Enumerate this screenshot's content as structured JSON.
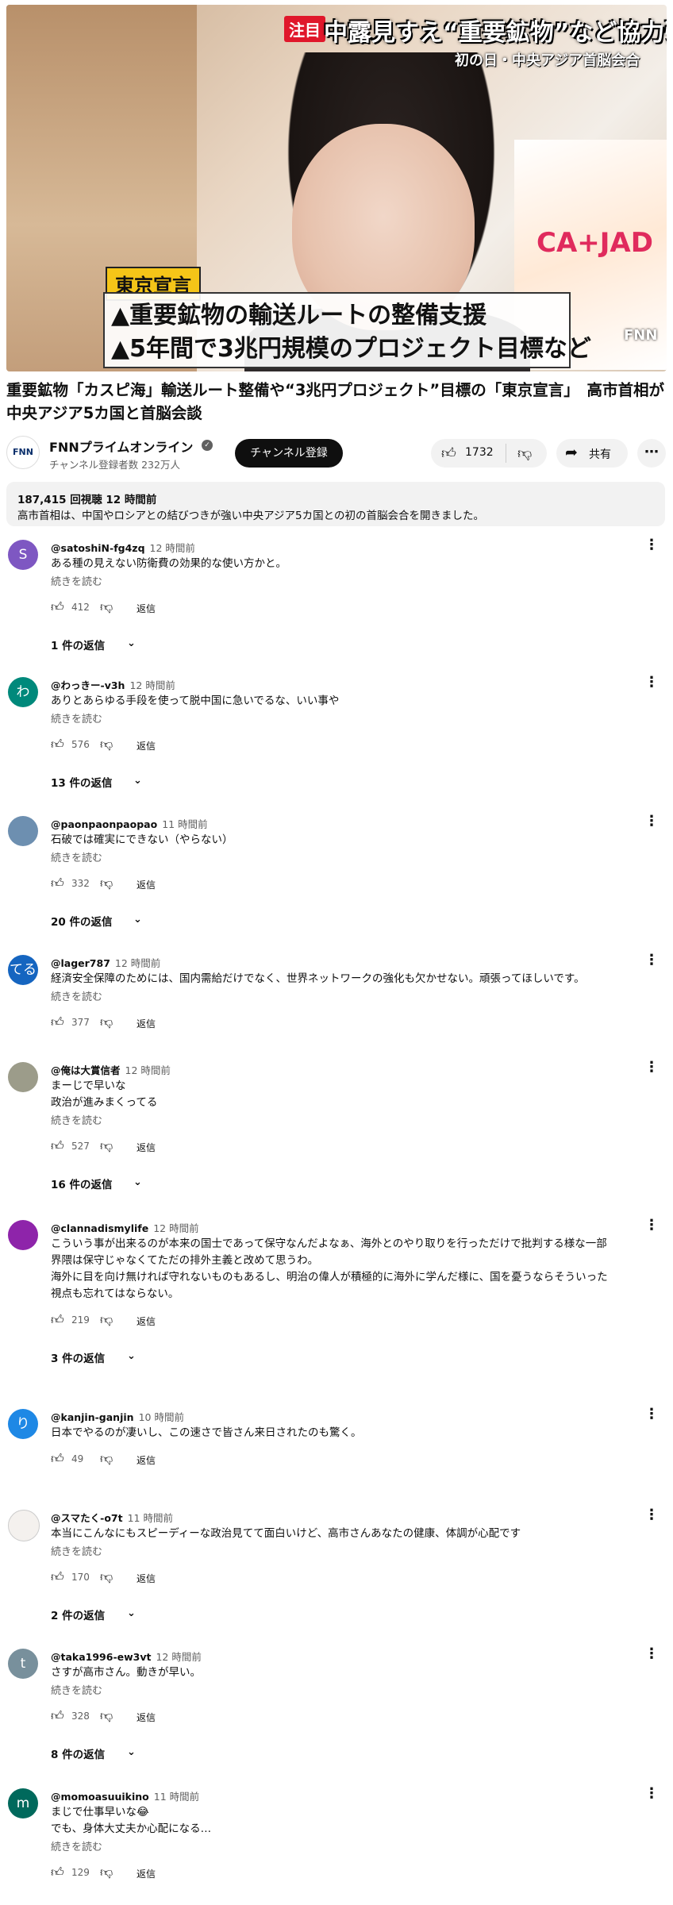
{
  "video": {
    "tag": "注目",
    "headline": "中露見すえ“重要鉱物”など協力強化",
    "subheadline": "初の日・中央アジア首脳会合",
    "box_label": "東京宣言",
    "caption_1": "▲重要鉱物の輸送ルートの整備支援",
    "caption_2": "▲5年間で3兆円規模のプロジェクト目標など",
    "backdrop_text": "CA+JAD",
    "logo": "FNN"
  },
  "title": "重要鉱物「カスピ海」輸送ルート整備や“3兆円プロジェクト”目標の「東京宣言」　高市首相が中央アジア5カ国と首脳会談",
  "channel": {
    "logo": "FNN",
    "name": "FNNプライムオンライン",
    "verified_icon": "check-icon",
    "subscribers": "チャンネル登録者数 232万人",
    "subscribe_label": "チャンネル登録"
  },
  "actions": {
    "like_count": "1732",
    "share_label": "共有"
  },
  "description": {
    "meta": "187,415 回視聴  12 時間前",
    "text": "高市首相は、中国やロシアとの結びつきが強い中央アジア5カ国との初の首脳会合を開きました。"
  },
  "common": {
    "read_more": "続きを読む",
    "reply": "返信"
  },
  "comments": [
    {
      "avatar": "S",
      "avatar_color": "#7e57c2",
      "handle": "@satoshiN-fg4zq",
      "time": "12 時間前",
      "lines": [
        "ある種の見えない防衛費の効果的な使い方かと。"
      ],
      "read_more": true,
      "likes": "412",
      "replies": "1 件の返信"
    },
    {
      "avatar": "わ",
      "avatar_color": "#00897b",
      "handle": "@わっきー-v3h",
      "time": "12 時間前",
      "lines": [
        "ありとあらゆる手段を使って脱中国に急いでるな、いい事や"
      ],
      "read_more": true,
      "likes": "576",
      "replies": "13 件の返信"
    },
    {
      "avatar": "",
      "avatar_color": "#6d8fb0",
      "handle": "@paonpaonpaopao",
      "time": "11 時間前",
      "lines": [
        "石破では確実にできない（やらない）"
      ],
      "read_more": true,
      "likes": "332",
      "replies": "20 件の返信"
    },
    {
      "avatar": "てる",
      "avatar_color": "#1565c0",
      "handle": "@lager787",
      "time": "12 時間前",
      "lines": [
        "経済安全保障のためには、国内需給だけでなく、世界ネットワークの強化も欠かせない。頑張ってほしいです。"
      ],
      "read_more": true,
      "likes": "377",
      "replies": ""
    },
    {
      "avatar": "",
      "avatar_color": "#9c9c8a",
      "handle": "@俺は大賞信者",
      "time": "12 時間前",
      "lines": [
        "まーじで早いな",
        "政治が進みまくってる"
      ],
      "read_more": true,
      "likes": "527",
      "replies": "16 件の返信"
    },
    {
      "avatar": "",
      "avatar_color": "#8e24aa",
      "handle": "@clannadismylife",
      "time": "12 時間前",
      "lines": [
        "こういう事が出来るのが本来の国士であって保守なんだよなぁ、海外とのやり取りを行っただけで批判する様な一部",
        "界隈は保守じゃなくてただの排外主義と改めて思うわ。",
        "海外に目を向け無ければ守れないものもあるし、明治の偉人が積極的に海外に学んだ様に、国を憂うならそういった",
        "視点も忘れてはならない。"
      ],
      "read_more": false,
      "likes": "219",
      "replies": "3 件の返信"
    },
    {
      "avatar": "り",
      "avatar_color": "#1e88e5",
      "handle": "@kanjin-ganjin",
      "time": "10 時間前",
      "lines": [
        "日本でやるのが凄いし、この速さで皆さん来日されたのも驚く。"
      ],
      "read_more": false,
      "likes": "49",
      "replies": ""
    },
    {
      "avatar": "",
      "avatar_color": "#f4f1ee",
      "handle": "@スマたく-o7t",
      "time": "11 時間前",
      "lines": [
        "本当にこんなにもスピーディーな政治見てて面白いけど、高市さんあなたの健康、体調が心配です"
      ],
      "read_more": true,
      "likes": "170",
      "replies": "2 件の返信"
    },
    {
      "avatar": "t",
      "avatar_color": "#78909c",
      "handle": "@taka1996-ew3vt",
      "time": "12 時間前",
      "lines": [
        "さすが高市さん。動きが早い。"
      ],
      "read_more": true,
      "likes": "328",
      "replies": "8 件の返信"
    },
    {
      "avatar": "m",
      "avatar_color": "#00695c",
      "handle": "@momoasuuikino",
      "time": "11 時間前",
      "lines": [
        "まじで仕事早いな😂",
        "でも、身体大丈夫か心配になる…"
      ],
      "read_more": true,
      "likes": "129",
      "replies": ""
    }
  ]
}
